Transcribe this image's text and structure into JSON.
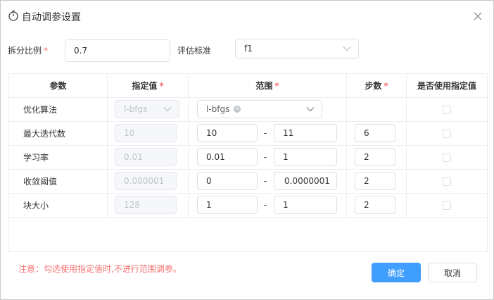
{
  "dialog": {
    "title": "自动调参设置"
  },
  "form": {
    "split_label": "拆分比例",
    "split_required": "*",
    "split_value": "0.7",
    "eval_label": "评估标准",
    "eval_value": "f1"
  },
  "table": {
    "headers": {
      "param": "参数",
      "specified": "指定值",
      "range": "范围",
      "steps": "步数",
      "use_specified": "是否使用指定值"
    },
    "required_mark": "*",
    "range_separator": "-",
    "rows": [
      {
        "name": "优化算法",
        "specified": "l-bfgs",
        "range_tag": "l-bfgs",
        "steps": ""
      },
      {
        "name": "最大迭代数",
        "specified": "10",
        "min": "10",
        "max": "11",
        "steps": "6"
      },
      {
        "name": "学习率",
        "specified": "0.01",
        "min": "0.01",
        "max": "1",
        "steps": "2"
      },
      {
        "name": "收敛阈值",
        "specified": "0.000001",
        "min": "0",
        "max": "0.0000001",
        "steps": "2"
      },
      {
        "name": "块大小",
        "specified": "128",
        "min": "1",
        "max": "1",
        "steps": "2"
      }
    ]
  },
  "note": "注意：勾选使用指定值时,不进行范围调参。",
  "buttons": {
    "confirm": "确定",
    "cancel": "取消"
  },
  "colors": {
    "primary": "#409eff",
    "required": "#f56c6c",
    "border": "#dcdfe6"
  }
}
